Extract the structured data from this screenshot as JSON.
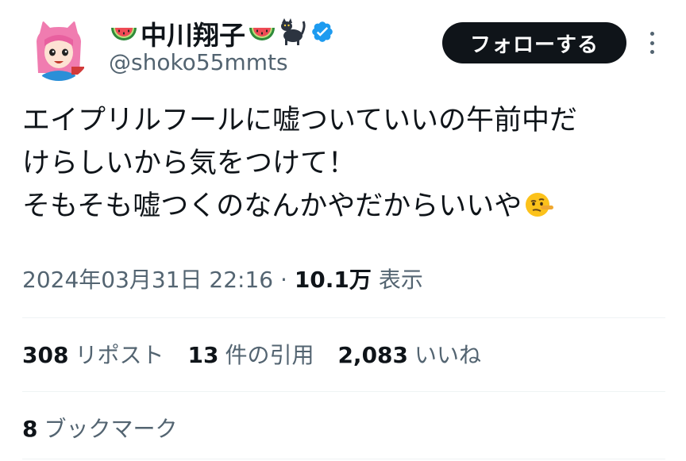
{
  "author": {
    "display_name": "中川翔子",
    "name_emojis": [
      "watermelon-emoji",
      "watermelon-emoji",
      "black-cat-emoji"
    ],
    "verified_badge": "verified-badge-icon",
    "handle": "@shoko55mmts",
    "avatar": "avatar-illustration"
  },
  "header": {
    "follow_label": "フォローする",
    "more_icon": "more-vertical-icon"
  },
  "tweet": {
    "lines": [
      "エイプリルフールに嘘ついていいの午前中だ",
      "けらしいから気をつけて！",
      "そもそも嘘つくのなんかやだからいいや"
    ],
    "trailing_emoji": "lying-face-emoji"
  },
  "meta": {
    "timestamp": "2024年03月31日 22:16",
    "separator": " · ",
    "views_count": "10.1万",
    "views_label": "表示"
  },
  "stats": {
    "reposts_count": "308",
    "reposts_label": "リポスト",
    "quotes_count": "13",
    "quotes_label": "件の引用",
    "likes_count": "2,083",
    "likes_label": "いいね",
    "bookmarks_count": "8",
    "bookmarks_label": "ブックマーク"
  },
  "colors": {
    "text_primary": "#0f1419",
    "text_secondary": "#536471",
    "verified_blue": "#1d9bf0",
    "divider": "#eff3f4",
    "follow_bg": "#0f1419"
  }
}
